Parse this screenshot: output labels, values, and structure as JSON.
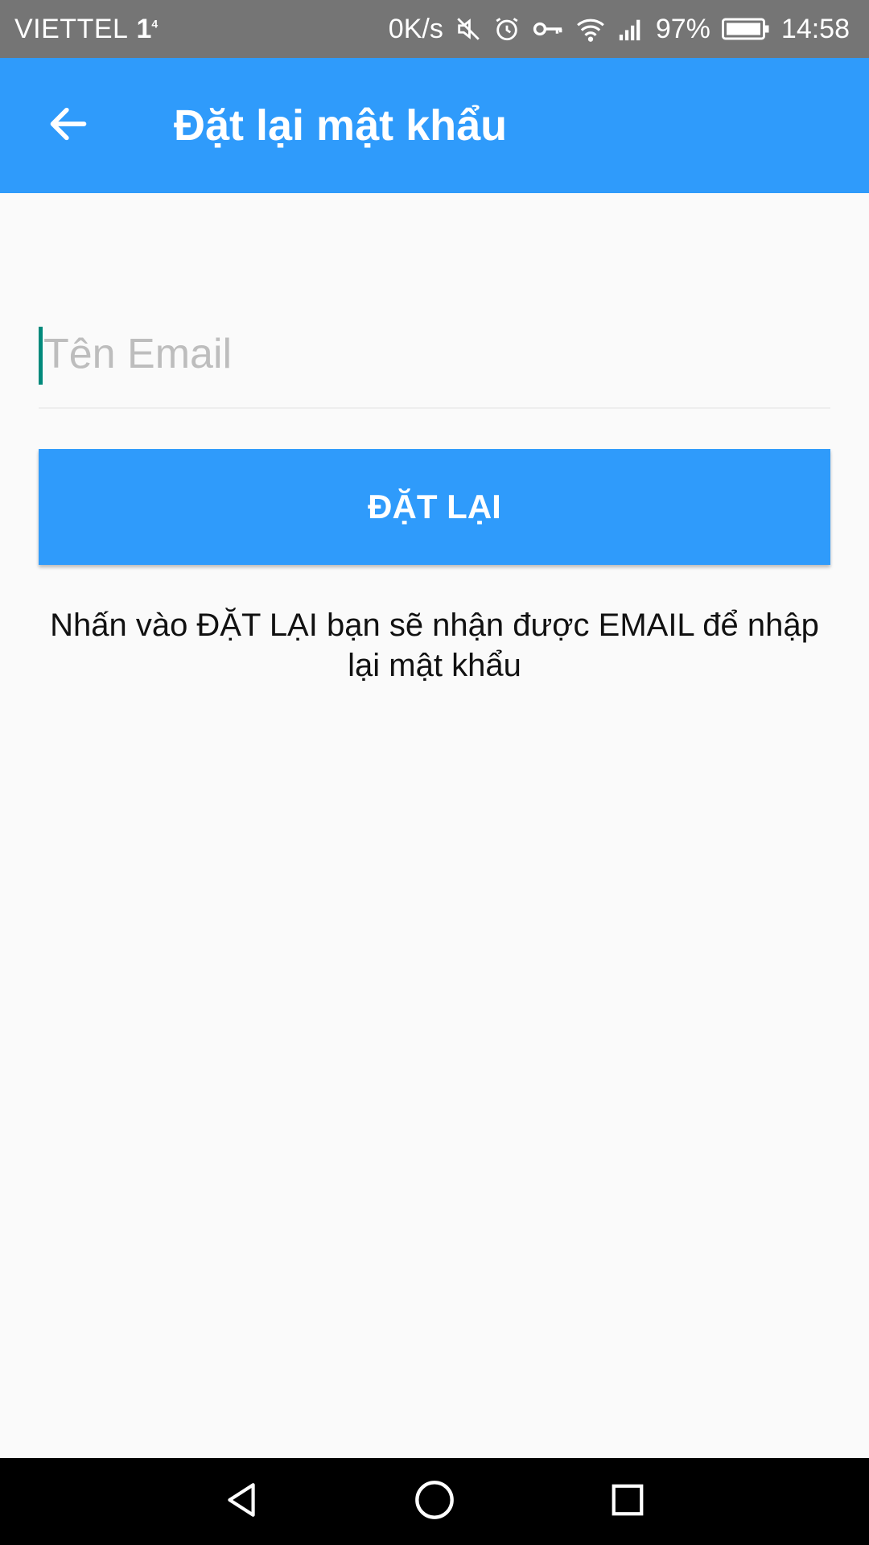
{
  "status_bar": {
    "carrier": "VIETTEL",
    "network_type": "1",
    "network_sup": "4",
    "speed": "0K/s",
    "battery": "97%",
    "time": "14:58",
    "icons": [
      "mute-icon",
      "alarm-icon",
      "vpn-key-icon",
      "wifi-icon",
      "signal-icon",
      "battery-icon"
    ]
  },
  "app_bar": {
    "title": "Đặt lại mật khẩu",
    "back_icon": "arrow-back-icon"
  },
  "form": {
    "email_placeholder": "Tên Email",
    "email_value": "",
    "reset_label": "ĐẶT LẠI",
    "hint_text": "Nhấn vào ĐẶT LẠI  bạn sẽ nhận được EMAIL để nhập lại mật khẩu"
  },
  "nav_bar": {
    "icons": [
      "back-triangle-icon",
      "home-circle-icon",
      "recents-square-icon"
    ]
  },
  "colors": {
    "primary": "#2f9bfb",
    "status_bar": "#757575",
    "background": "#fafafa",
    "caret": "#00897b"
  }
}
